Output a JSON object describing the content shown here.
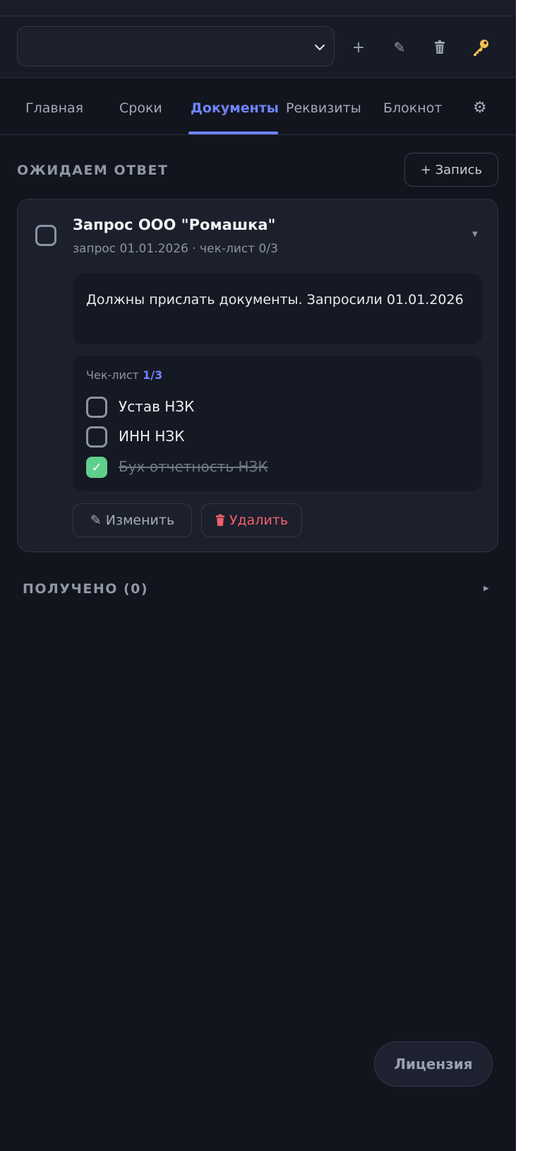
{
  "toolbar": {
    "select_value": "",
    "add_icon": "plus-icon",
    "edit_icon": "pencil-icon",
    "delete_icon": "trash-icon",
    "key_icon": "key-icon"
  },
  "tabs": [
    {
      "label": "Главная"
    },
    {
      "label": "Сроки"
    },
    {
      "label": "Документы",
      "active": true
    },
    {
      "label": "Реквизиты"
    },
    {
      "label": "Блокнот"
    }
  ],
  "tabs_settings_icon": "gear-icon",
  "awaiting": {
    "title": "ОЖИДАЕМ ОТВЕТ",
    "add_label": "+ Запись",
    "card": {
      "title": "Запрос ООО \"Ромашка\"",
      "subtitle": "запрос 01.01.2026 · чек-лист 0/3",
      "note": "Должны прислать документы. Запросили 01.01.2026",
      "checklist_label": "Чек-лист",
      "checklist_count": "1/3",
      "items": [
        {
          "label": "Устав НЗК",
          "checked": false
        },
        {
          "label": "ИНН НЗК",
          "checked": false
        },
        {
          "label": "Бух отчетность НЗК",
          "checked": true
        }
      ],
      "edit_label": "Изменить",
      "delete_label": "Удалить"
    }
  },
  "received": {
    "title": "ПОЛУЧЕНО (0)"
  },
  "license_label": "Лицензия",
  "colors": {
    "accent": "#6f84ff",
    "success": "#5fcf8c",
    "danger": "#f0616e",
    "background": "#12151e"
  }
}
